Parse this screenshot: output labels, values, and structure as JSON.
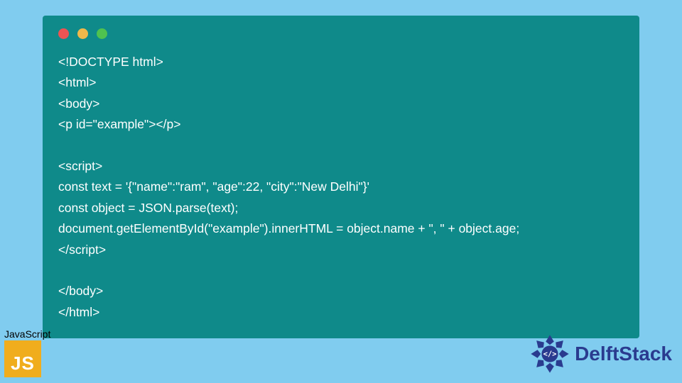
{
  "code": {
    "lines": [
      "<!DOCTYPE html>",
      "<html>",
      "<body>",
      "<p id=\"example\"></p>",
      "",
      "<script>",
      "const text = '{\"name\":\"ram\", \"age\":22, \"city\":\"New Delhi\"}'",
      "const object = JSON.parse(text);",
      "document.getElementById(\"example\").innerHTML = object.name + \", \" + object.age;",
      "</script>",
      "",
      "</body>",
      "</html>"
    ]
  },
  "badge": {
    "language_label": "JavaScript",
    "language_short": "JS"
  },
  "brand": {
    "name": "DelftStack"
  },
  "colors": {
    "page_bg": "#80ccef",
    "window_bg": "#0f8a8a",
    "code_text": "#ffffff",
    "js_box": "#f0ad1d",
    "brand_text": "#2a3b8f"
  }
}
